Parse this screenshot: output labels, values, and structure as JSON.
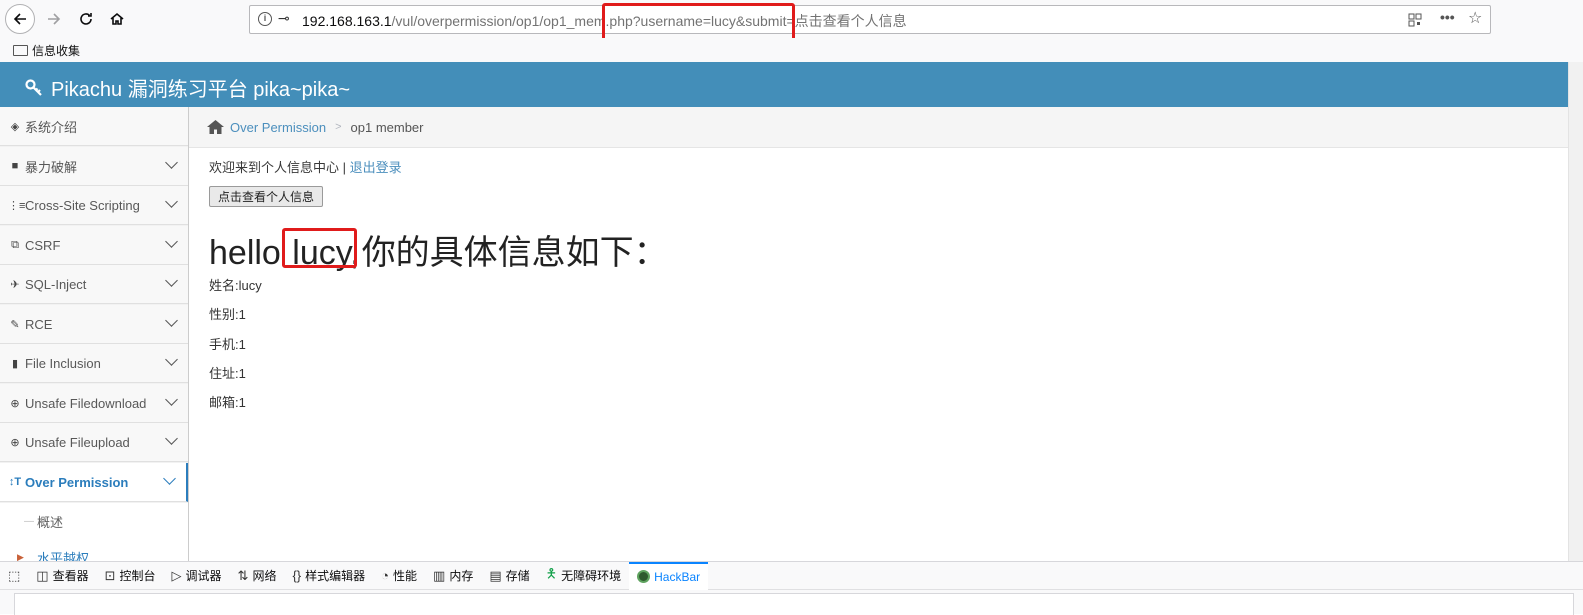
{
  "browser": {
    "url_host": "192.168.163.1",
    "url_path": "/vul/overpermission/op1/op1_mem.php?username=lucy&submit=点击查看个人信息",
    "bookmark_folder": "信息收集"
  },
  "app": {
    "title": "Pikachu 漏洞练习平台 pika~pika~"
  },
  "sidebar": {
    "items": [
      {
        "label": "系统介绍",
        "icon": "tags-icon"
      },
      {
        "label": "暴力破解",
        "icon": "lock-icon"
      },
      {
        "label": "Cross-Site Scripting",
        "icon": "list-icon"
      },
      {
        "label": "CSRF",
        "icon": "share-icon"
      },
      {
        "label": "SQL-Inject",
        "icon": "plane-icon"
      },
      {
        "label": "RCE",
        "icon": "pencil-icon"
      },
      {
        "label": "File Inclusion",
        "icon": "file-icon"
      },
      {
        "label": "Unsafe Filedownload",
        "icon": "download-icon"
      },
      {
        "label": "Unsafe Fileupload",
        "icon": "upload-icon"
      },
      {
        "label": "Over Permission",
        "icon": "text-height-icon"
      }
    ],
    "subitems": [
      "概述",
      "水平越权"
    ]
  },
  "breadcrumb": {
    "parent": "Over Permission",
    "current": "op1 member"
  },
  "content": {
    "welcome_text": "欢迎来到个人信息中心 | ",
    "logout_link": "退出登录",
    "view_button": "点击查看个人信息",
    "hello_prefix": "hello",
    "hello_user": "lucy,",
    "hello_suffix": "你的具体信息如下：",
    "info": [
      "姓名:lucy",
      "性别:1",
      "手机:1",
      "住址:1",
      "邮箱:1"
    ]
  },
  "devtools": {
    "tabs": [
      "查看器",
      "控制台",
      "调试器",
      "网络",
      "样式编辑器",
      "性能",
      "内存",
      "存储",
      "无障碍环境",
      "HackBar"
    ]
  },
  "colors": {
    "header": "#438eb9",
    "link": "#4c8fbd",
    "highlight": "#e01b1b"
  }
}
